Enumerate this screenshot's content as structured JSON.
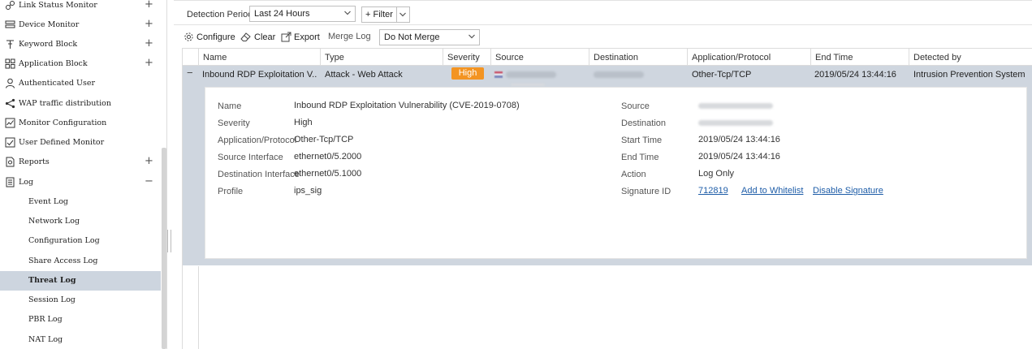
{
  "sidebar": {
    "items": [
      {
        "label": "Link Status Monitor",
        "icon": "link-status-icon",
        "toggle": "+"
      },
      {
        "label": "Device Monitor",
        "icon": "device-monitor-icon",
        "toggle": "+"
      },
      {
        "label": "Keyword Block",
        "icon": "keyword-block-icon",
        "toggle": "+"
      },
      {
        "label": "Application Block",
        "icon": "application-block-icon",
        "toggle": "+"
      },
      {
        "label": "Authenticated User",
        "icon": "user-icon"
      },
      {
        "label": "WAP traffic distribution",
        "icon": "share-icon"
      },
      {
        "label": "Monitor Configuration",
        "icon": "monitor-config-icon"
      },
      {
        "label": "User Defined Monitor",
        "icon": "user-defined-monitor-icon"
      },
      {
        "label": "Reports",
        "icon": "reports-icon",
        "toggle": "+"
      },
      {
        "label": "Log",
        "icon": "log-icon",
        "toggle": "−"
      }
    ],
    "log_children": [
      "Event Log",
      "Network Log",
      "Configuration Log",
      "Share Access Log",
      "Threat Log",
      "Session Log",
      "PBR Log",
      "NAT Log"
    ],
    "active": "Threat Log"
  },
  "toolbar": {
    "period_label": "Detection Period",
    "period_value": "Last 24 Hours",
    "filter_label": "+ Filter"
  },
  "actions": {
    "configure": "Configure",
    "clear": "Clear",
    "export": "Export",
    "merge_label": "Merge Log",
    "merge_value": "Do Not Merge"
  },
  "table": {
    "columns": [
      "Name",
      "Type",
      "Severity",
      "Source",
      "Destination",
      "Application/Protocol",
      "End Time",
      "Detected by"
    ],
    "row": {
      "toggle": "−",
      "name": "Inbound RDP Exploitation V...",
      "type": "Attack - Web Attack",
      "severity": "High",
      "application": "Other-Tcp/TCP",
      "end_time": "2019/05/24 13:44:16",
      "detected_by": "Intrusion Prevention System"
    }
  },
  "detail": {
    "left": [
      {
        "label": "Name",
        "value": "Inbound RDP Exploitation Vulnerability (CVE-2019-0708)"
      },
      {
        "label": "Severity",
        "value": "High"
      },
      {
        "label": "Application/Protocol",
        "value": "Other-Tcp/TCP"
      },
      {
        "label": "Source Interface",
        "value": "ethernet0/5.2000"
      },
      {
        "label": "Destination Interface",
        "value": "ethernet0/5.1000"
      },
      {
        "label": "Profile",
        "value": "ips_sig"
      }
    ],
    "right": {
      "source_label": "Source",
      "destination_label": "Destination",
      "start_time_label": "Start Time",
      "start_time": "2019/05/24 13:44:16",
      "end_time_label": "End Time",
      "end_time": "2019/05/24 13:44:16",
      "action_label": "Action",
      "action": "Log Only",
      "signature_label": "Signature ID",
      "signature_id": "712819",
      "whitelist_link": "Add to Whitelist",
      "disable_link": "Disable Signature"
    }
  },
  "colors": {
    "severity_high": "#f39422",
    "selected_row": "#cfd6df",
    "link": "#1e5da8"
  }
}
